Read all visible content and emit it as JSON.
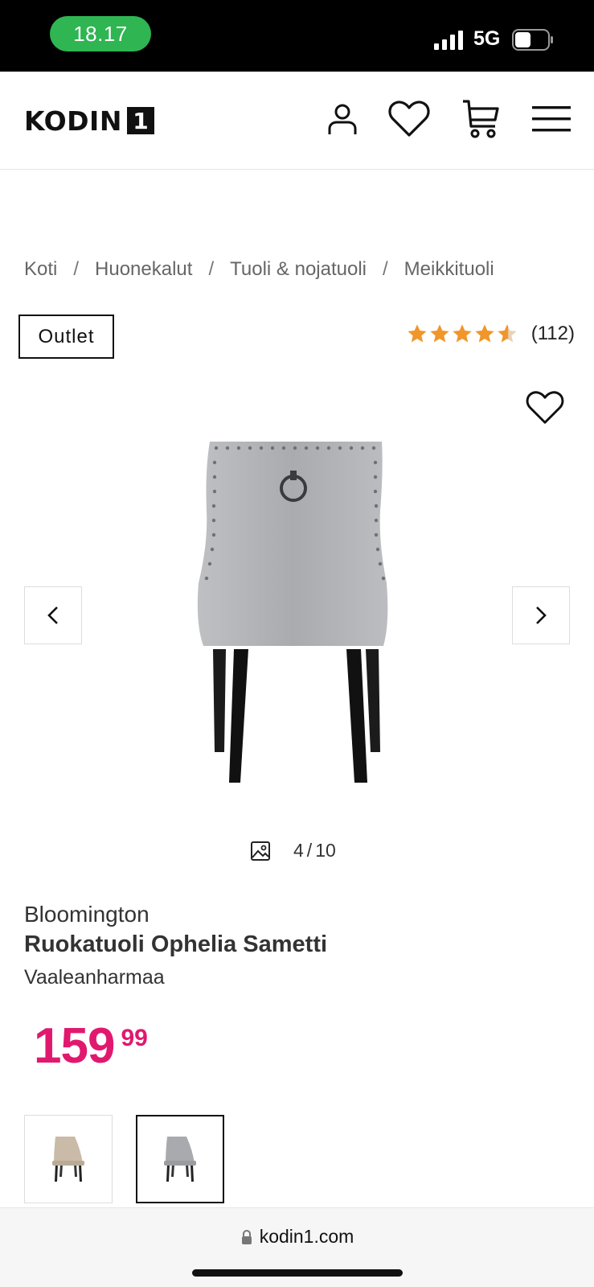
{
  "status_bar": {
    "time": "18.17",
    "network": "5G",
    "time_pill_color": "#2fb552"
  },
  "header": {
    "logo_text": "KODIN",
    "logo_number": "1",
    "icons": [
      "user-icon",
      "heart-icon",
      "cart-icon",
      "menu-icon"
    ]
  },
  "breadcrumb": {
    "items": [
      "Koti",
      "Huonekalut",
      "Tuoli & nojatuoli",
      "Meikkituoli"
    ],
    "separator": "/"
  },
  "badge": {
    "label": "Outlet"
  },
  "rating": {
    "stars": 4.5,
    "max_stars": 5,
    "count_text": "(112)",
    "star_color": "#f0962a"
  },
  "gallery": {
    "counter_current": "4",
    "counter_separator": "/",
    "counter_total": "10"
  },
  "product": {
    "brand": "Bloomington",
    "name": "Ruokatuoli Ophelia Sametti",
    "color": "Vaaleanharmaa",
    "price_int": "159",
    "price_dec": "99",
    "price_color": "#e0196f"
  },
  "thumbnails": [
    {
      "variant": "beige"
    },
    {
      "variant": "grey",
      "selected": true
    }
  ],
  "browser": {
    "url": "kodin1.com"
  }
}
